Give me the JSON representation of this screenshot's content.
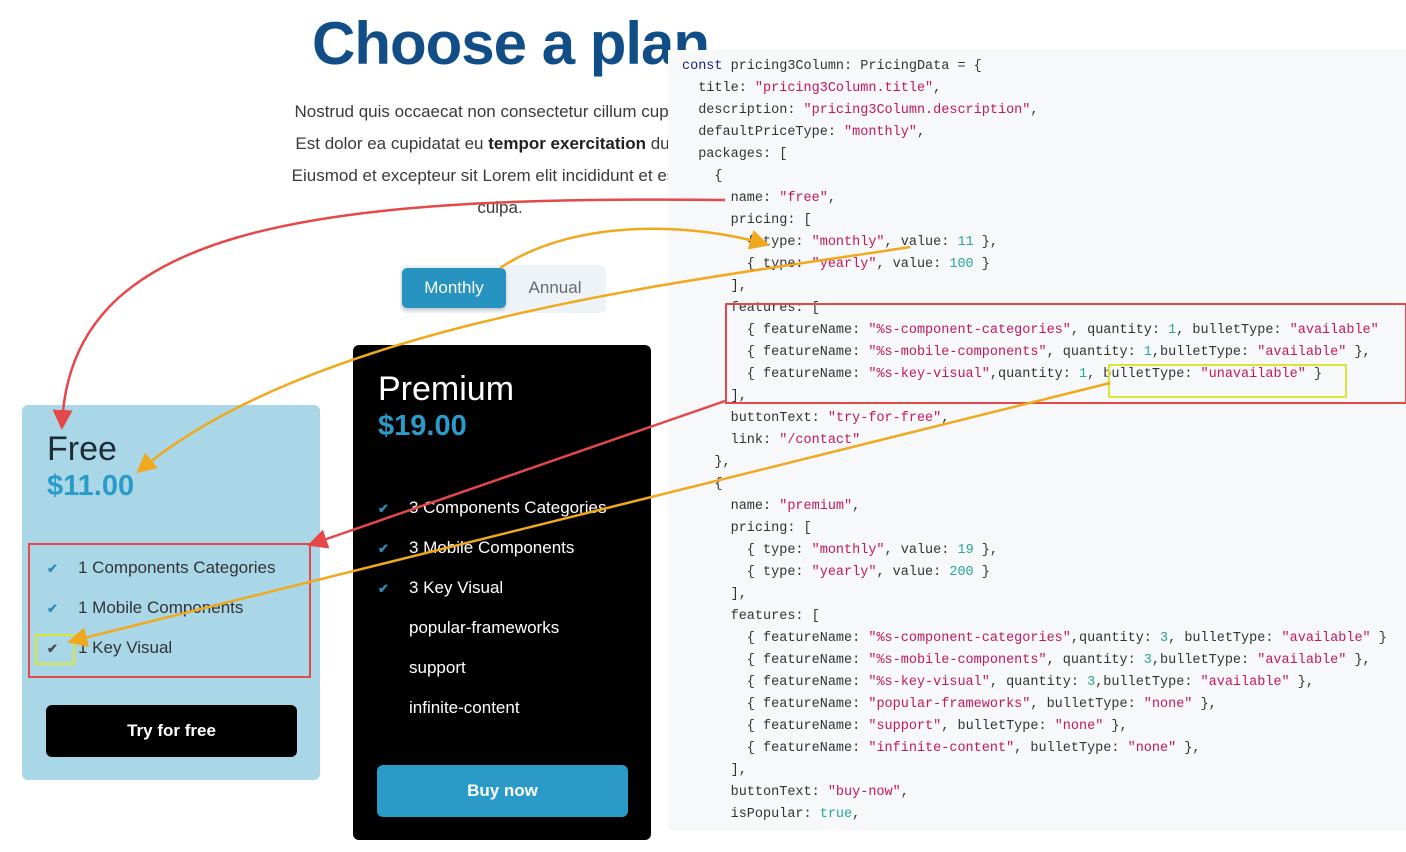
{
  "header": {
    "title": "Choose a plan",
    "description_lines": [
      "Nostrud quis occaecat non consectetur cillum cupidata",
      "Eiusmod et excepteur sit Lorem elit incididunt et est sur",
      "culpa."
    ],
    "description_line2_pre": "Est dolor ea cupidatat eu ",
    "description_line2_bold": "tempor exercitation",
    "description_line2_post": " duis ve"
  },
  "toggle": {
    "options": [
      "Monthly",
      "Annual"
    ],
    "selected": "Monthly",
    "active_color": "#2693c0"
  },
  "plans": [
    {
      "name": "Free",
      "price": "$11.00",
      "background": "#a9d7e8",
      "features": [
        {
          "text": "1 Components Categories",
          "bullet": "available"
        },
        {
          "text": "1 Mobile Components",
          "bullet": "available"
        },
        {
          "text": "1 Key Visual",
          "bullet": "unavailable"
        }
      ],
      "button": "Try for free"
    },
    {
      "name": "Premium",
      "price": "$19.00",
      "background": "#000000",
      "features": [
        {
          "text": "3 Components Categories",
          "bullet": "available"
        },
        {
          "text": "3 Mobile Components",
          "bullet": "available"
        },
        {
          "text": "3 Key Visual",
          "bullet": "available"
        },
        {
          "text": "popular-frameworks",
          "bullet": "none"
        },
        {
          "text": "support",
          "bullet": "none"
        },
        {
          "text": "infinite-content",
          "bullet": "none"
        }
      ],
      "button": "Buy now"
    }
  ],
  "code": {
    "lines": [
      "const pricing3Column: PricingData = {",
      "  title: \"pricing3Column.title\",",
      "  description: \"pricing3Column.description\",",
      "  defaultPriceType: \"monthly\",",
      "  packages: [",
      "    {",
      "      name: \"free\",",
      "      pricing: [",
      "        { type: \"monthly\", value: 11 },",
      "        { type: \"yearly\", value: 100 }",
      "      ],",
      "      features: [",
      "        { featureName: \"%s-component-categories\", quantity: 1, bulletType: \"available\"",
      "        { featureName: \"%s-mobile-components\", quantity: 1,bulletType: \"available\" },",
      "        { featureName: \"%s-key-visual\",quantity: 1, bulletType: \"unavailable\" }",
      "      ],",
      "      buttonText: \"try-for-free\",",
      "      link: \"/contact\"",
      "    },",
      "    {",
      "      name: \"premium\",",
      "      pricing: [",
      "        { type: \"monthly\", value: 19 },",
      "        { type: \"yearly\", value: 200 }",
      "      ],",
      "      features: [",
      "        { featureName: \"%s-component-categories\",quantity: 3, bulletType: \"available\" }",
      "        { featureName: \"%s-mobile-components\", quantity: 3,bulletType: \"available\" },",
      "        { featureName: \"%s-key-visual\", quantity: 3,bulletType: \"available\" },",
      "        { featureName: \"popular-frameworks\", bulletType: \"none\" },",
      "        { featureName: \"support\", bulletType: \"none\" },",
      "        { featureName: \"infinite-content\", bulletType: \"none\" },",
      "      ],",
      "      buttonText: \"buy-now\",",
      "      isPopular: true,"
    ]
  },
  "annotation_colors": {
    "red": "#e54848",
    "orange": "#f0a81c",
    "yellow": "#d9e635"
  }
}
